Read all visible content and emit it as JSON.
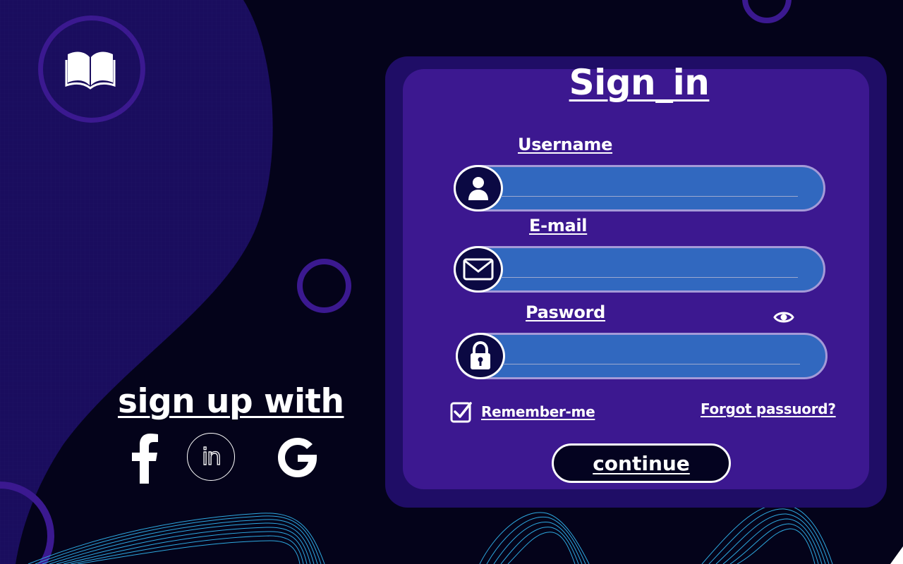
{
  "left_panel": {
    "signup_title": "sign up with",
    "social_icons": [
      "facebook-icon",
      "linkedin-icon",
      "google-icon"
    ],
    "linkedin_glyph": "in"
  },
  "form": {
    "title": "Sign_in",
    "fields": [
      {
        "label": "Username",
        "icon": "user-icon",
        "value": "",
        "placeholder": ""
      },
      {
        "label": "E-mail",
        "icon": "mail-icon",
        "value": "",
        "placeholder": ""
      },
      {
        "label": "Pasword",
        "icon": "lock-icon",
        "value": "",
        "placeholder": ""
      }
    ],
    "show_password_icon": "eye-icon",
    "remember_label": "Remember-me",
    "remember_checked": true,
    "forgot_label": "Forgot passuord?",
    "submit_label": "continue"
  },
  "colors": {
    "background": "#04031a",
    "card": "#3c1890",
    "card_border": "#1f0d66",
    "field": "#3168bf",
    "accent_ring": "#3b1990",
    "wave": "#2ea9e0"
  }
}
